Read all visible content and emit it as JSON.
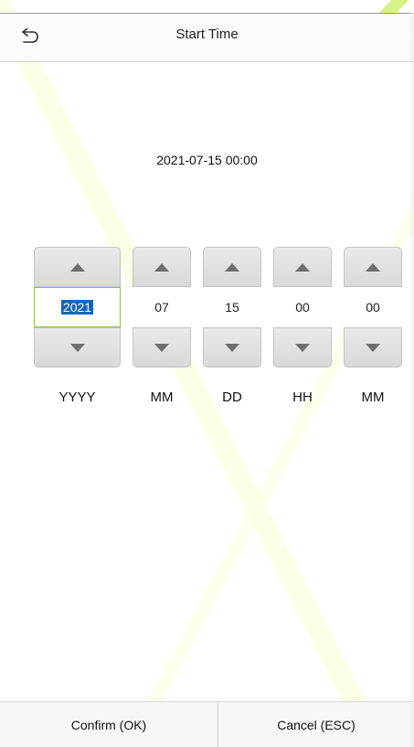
{
  "header": {
    "title": "Start Time",
    "back_icon": "back-arrow-icon"
  },
  "summary": {
    "datetime": "2021-07-15 00:00"
  },
  "spinners": [
    {
      "field": "year",
      "value": "2021",
      "label": "YYYY",
      "active": true
    },
    {
      "field": "month",
      "value": "07",
      "label": "MM",
      "active": false
    },
    {
      "field": "day",
      "value": "15",
      "label": "DD",
      "active": false
    },
    {
      "field": "hour",
      "value": "00",
      "label": "HH",
      "active": false
    },
    {
      "field": "minute",
      "value": "00",
      "label": "MM",
      "active": false
    }
  ],
  "icons": {
    "increment": "triangle-up-icon",
    "decrement": "triangle-down-icon"
  },
  "footer": {
    "confirm_label": "Confirm (OK)",
    "cancel_label": "Cancel (ESC)"
  },
  "colors": {
    "selection": "#1565c0",
    "active_border": "#8bc34a",
    "arrow_glyph": "#6f6f6f"
  }
}
